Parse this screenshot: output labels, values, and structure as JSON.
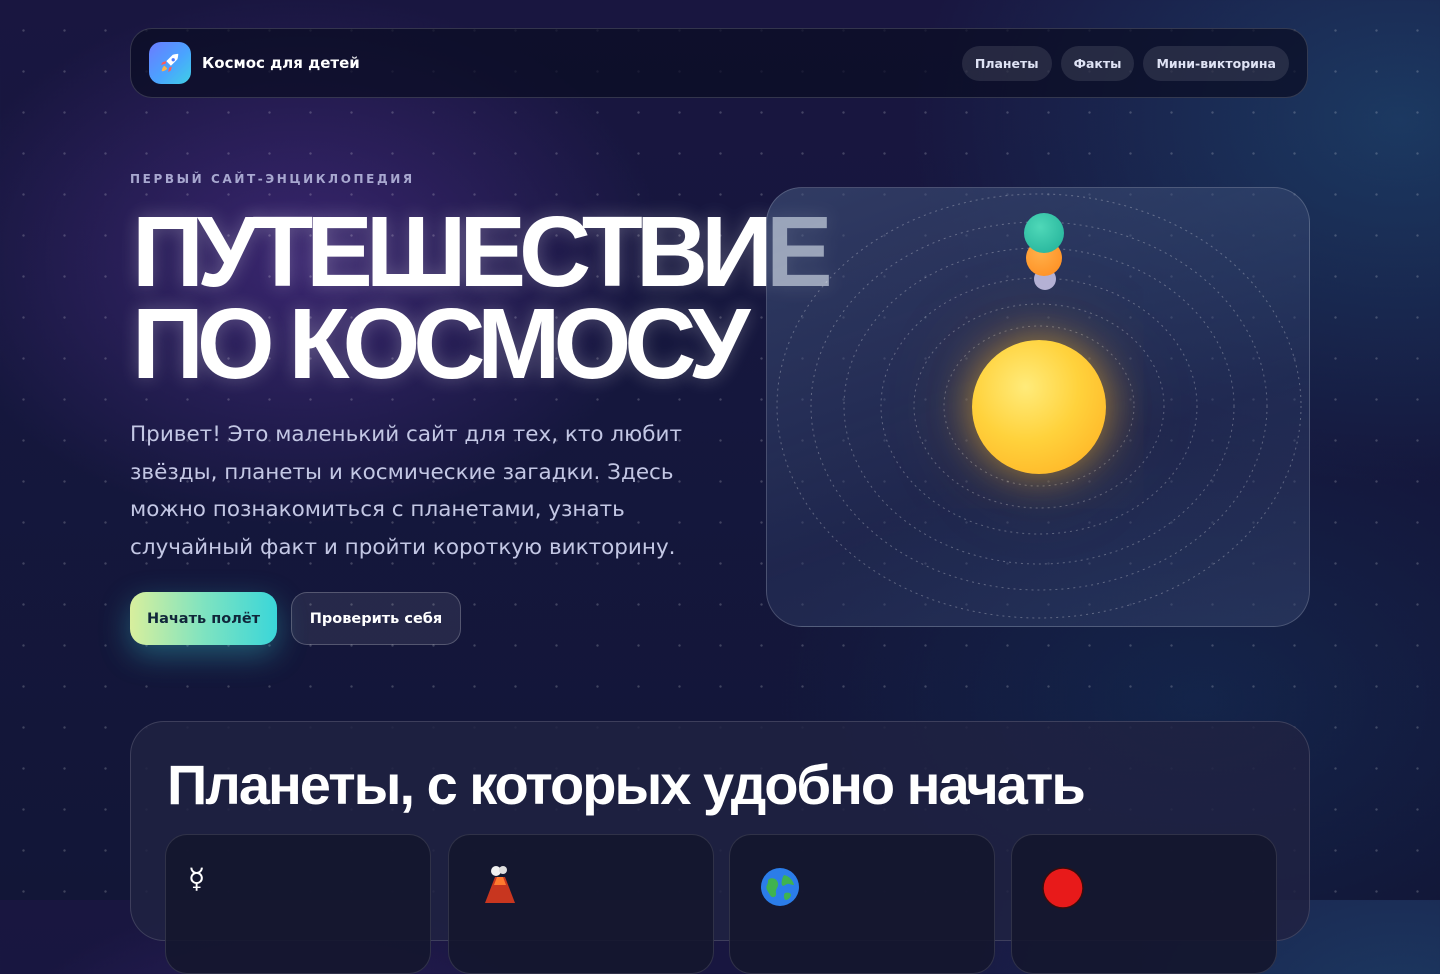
{
  "nav": {
    "brand": "Космос для детей",
    "logo_icon": "rocket-icon",
    "links": [
      "Планеты",
      "Факты",
      "Мини-викторина"
    ]
  },
  "hero": {
    "eyebrow": "ПЕРВЫЙ САЙТ-ЭНЦИКЛОПЕДИЯ",
    "title_line1": "ПУТЕШЕСТВИЕ",
    "title_line2": "ПО КОСМОСУ",
    "description": "Привет! Это маленький сайт для тех, кто любит звёзды, планеты и космические загадки. Здесь можно познакомиться с планетами, узнать случайный факт и пройти короткую викторину.",
    "primary_button": "Начать полёт",
    "secondary_button": "Проверить себя"
  },
  "planets_section": {
    "title": "Планеты, с которых удобно начать",
    "cards": [
      {
        "icon": "mercury-symbol-icon",
        "glyph": "☿"
      },
      {
        "icon": "volcano-icon"
      },
      {
        "icon": "earth-globe-icon"
      },
      {
        "icon": "red-circle-icon"
      }
    ]
  },
  "colors": {
    "accent_gradient_start": "#d8ef9d",
    "accent_gradient_end": "#3ad6d9",
    "sun": "#ffc12e",
    "background": "#15173d"
  }
}
